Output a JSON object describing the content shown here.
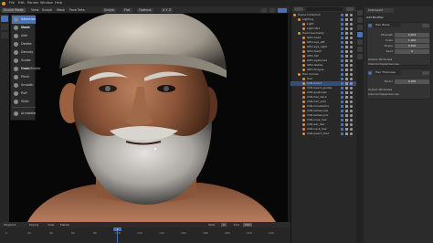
{
  "topbar": {
    "menus": [
      "File",
      "Edit",
      "Render",
      "Window",
      "Help"
    ]
  },
  "header": {
    "mode": "Sculpt Mode",
    "view": "View",
    "sculpt": "Sculpt",
    "mask": "Mask",
    "face_sets": "Face Sets",
    "shading": "Flat",
    "options": "Options",
    "x_mirror": "X Y Z"
  },
  "brushes": [
    {
      "label": "Selection Mask",
      "active": true
    },
    {
      "label": "Comb",
      "active": false
    },
    {
      "label": "Add",
      "active": false
    },
    {
      "label": "Delete",
      "active": false
    },
    {
      "label": "Density",
      "active": false
    },
    {
      "label": "Snake Hook",
      "active": false
    },
    {
      "label": "Grow/Shrink",
      "active": false
    },
    {
      "label": "Pinch",
      "active": false
    },
    {
      "label": "Smooth",
      "active": false
    },
    {
      "label": "Puff",
      "active": false
    },
    {
      "label": "Slide",
      "active": false
    },
    {
      "label": "Annotate",
      "active": false
    }
  ],
  "timeline": {
    "playback": "Playback",
    "keying": "Keying",
    "view": "View",
    "marker": "Marker",
    "current_frame": "1",
    "start": "Start",
    "start_value": "1",
    "end": "End",
    "end_value": "250",
    "ticks": [
      "0",
      "20",
      "40",
      "60",
      "80",
      "100",
      "120",
      "140",
      "160",
      "180",
      "200",
      "220",
      "240"
    ]
  },
  "outliner": {
    "header": "Scene Collection",
    "rows": [
      {
        "label": "Scene Collection",
        "indent": 0,
        "selected": false
      },
      {
        "label": "Lighting",
        "indent": 1,
        "selected": false
      },
      {
        "label": "Light",
        "indent": 2,
        "selected": false
      },
      {
        "label": "Light.001",
        "indent": 2,
        "selected": false
      },
      {
        "label": "Head Geometry",
        "indent": 1,
        "selected": false
      },
      {
        "label": "GEO-head",
        "indent": 2,
        "selected": false
      },
      {
        "label": "GEO-eye_left",
        "indent": 2,
        "selected": false
      },
      {
        "label": "GEO-eye_right",
        "indent": 2,
        "selected": false
      },
      {
        "label": "GEO-teeth",
        "indent": 2,
        "selected": false
      },
      {
        "label": "GEO-hat",
        "indent": 2,
        "selected": false
      },
      {
        "label": "GEO-eyebrows",
        "indent": 2,
        "selected": false
      },
      {
        "label": "GEO-lashes",
        "indent": 2,
        "selected": false
      },
      {
        "label": "GEO-tongue",
        "indent": 2,
        "selected": false
      },
      {
        "label": "Hair Curves",
        "indent": 1,
        "selected": false
      },
      {
        "label": "Hair",
        "indent": 2,
        "selected": false
      },
      {
        "label": "CUR-beard",
        "indent": 2,
        "selected": true
      },
      {
        "label": "CUR-beard_guides",
        "indent": 2,
        "selected": false
      },
      {
        "label": "CUR-eyebrows",
        "indent": 2,
        "selected": false
      },
      {
        "label": "CUR-hair_back",
        "indent": 2,
        "selected": false
      },
      {
        "label": "CUR-hair_side",
        "indent": 2,
        "selected": false
      },
      {
        "label": "CUR-moustache",
        "indent": 2,
        "selected": false
      },
      {
        "label": "CUR-lashes_top",
        "indent": 2,
        "selected": false
      },
      {
        "label": "CUR-lashes_bot",
        "indent": 2,
        "selected": false
      },
      {
        "label": "CUR-nose_hair",
        "indent": 2,
        "selected": false
      },
      {
        "label": "CUR-ear_hair",
        "indent": 2,
        "selected": false
      },
      {
        "label": "CUR-neck_hair",
        "indent": 2,
        "selected": false
      },
      {
        "label": "CUR-peach_fuzz",
        "indent": 2,
        "selected": false
      }
    ]
  },
  "properties": {
    "object_name": "CUR-beard",
    "add_modifier": "Add Modifier",
    "modifier1": {
      "name": "Hair Noise",
      "fields": [
        {
          "label": "Strength",
          "value": "0.003"
        },
        {
          "label": "Scale",
          "value": "1.000"
        },
        {
          "label": "Shape",
          "value": "0.300"
        },
        {
          "label": "Seed",
          "value": "0"
        }
      ],
      "output": "Output Attributes",
      "internal": "Internal Dependencies"
    },
    "modifier2": {
      "name": "Hair Thickness",
      "fields": [
        {
          "label": "Factor",
          "value": "0.005"
        }
      ],
      "output": "Output Attributes",
      "internal": "Internal Dependencies"
    }
  },
  "colors": {
    "accent": "#4772b3",
    "selected_row": "#334d80"
  }
}
